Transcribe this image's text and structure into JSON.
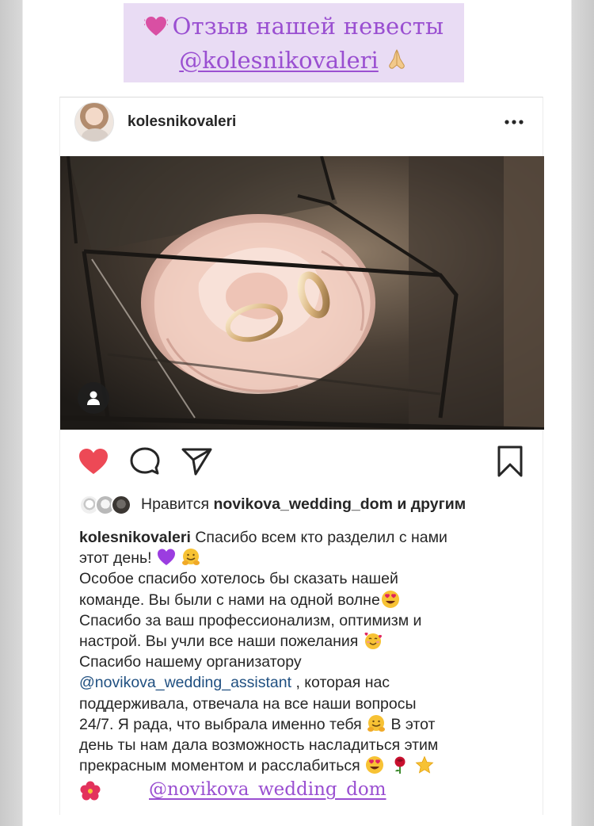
{
  "banner": {
    "title": "Отзыв нашей невесты",
    "handle": "@kolesnikovaleri",
    "heart_icon": "purple-heart-emoji",
    "pray_icon": "praying-hands-emoji"
  },
  "post": {
    "username": "kolesnikovaleri",
    "more_icon": "more-options-icon",
    "photo_subject": "pink rose with gold wedding rings in a glass box",
    "colors": {
      "like_red": "#ed4956",
      "mention_blue": "#1f4f80",
      "banner_purple": "#9a4fd1",
      "banner_bg": "#e9dcf4"
    }
  },
  "likes": {
    "prefix": "Нравится",
    "user": "novikova_wedding_dom",
    "suffix": "и другим"
  },
  "caption": {
    "author": "kolesnikovaleri",
    "l1": "Спасибо всем кто разделил с нами",
    "l2": "этот день!",
    "l3": "Особое спасибо хотелось бы сказать нашей",
    "l4": "команде. Вы были с нами на одной волне",
    "l5": "Спасибо за ваш профессионализм, оптимизм и",
    "l6": "настрой. Вы учли все наши пожелания",
    "l7": "Спасибо нашему организатору",
    "l8_mention": "@novikova_wedding_assistant",
    "l8_rest": ", которая нас",
    "l9": "поддерживала, отвечала на все наши вопросы",
    "l10": "24/7. Я рада, что выбрала именно тебя",
    "l10_rest": "В этот",
    "l11": "день ты нам дала возможность насладиться этим",
    "l12": "прекрасным моментом и расслабиться",
    "footer_link": "@novikova_wedding_dom"
  }
}
